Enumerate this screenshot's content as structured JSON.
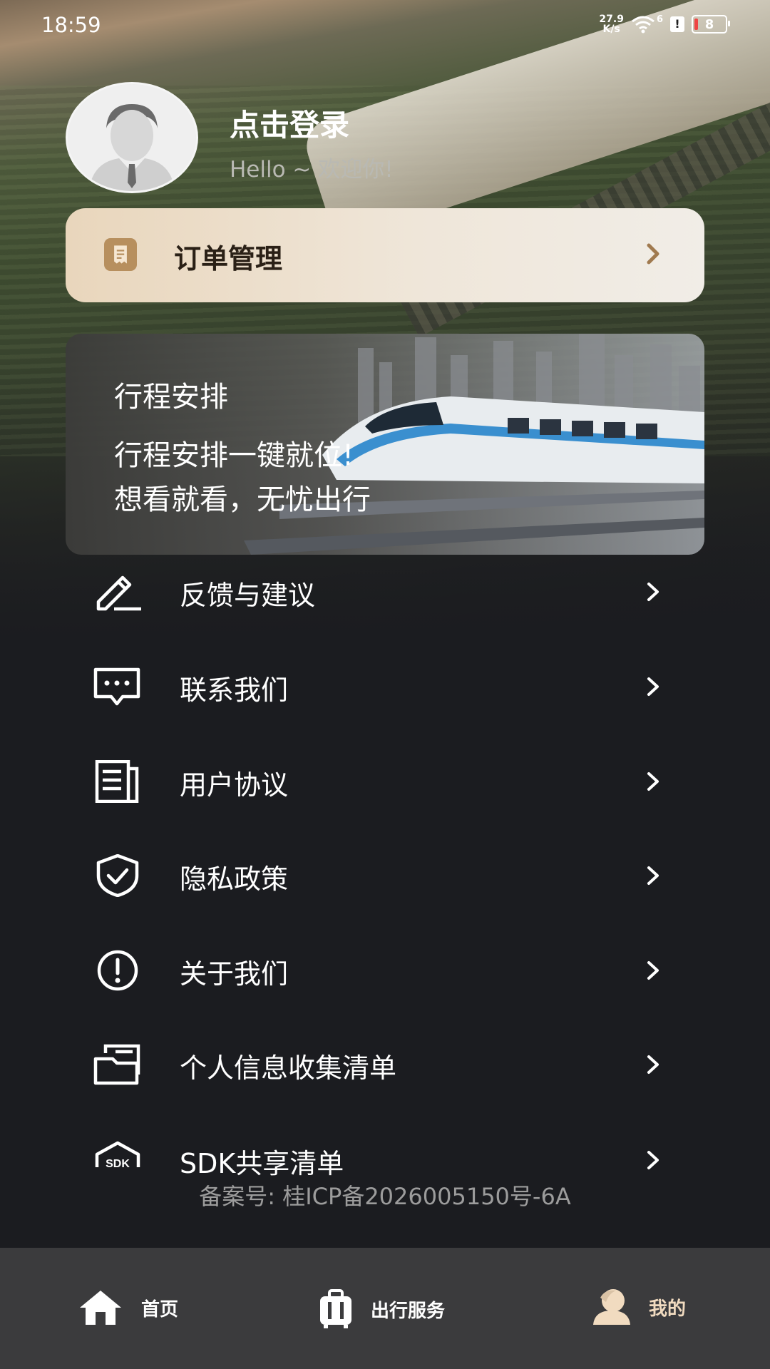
{
  "status": {
    "time": "18:59",
    "net_speed_top": "27.9",
    "net_speed_bottom": "K/s",
    "wifi_badge": "6",
    "alert": "!",
    "battery": "8"
  },
  "profile": {
    "title": "点击登录",
    "subtitle": "Hello ~ 欢迎你!"
  },
  "order": {
    "label": "订单管理"
  },
  "trip": {
    "title": "行程安排",
    "line1": "行程安排一键就位!",
    "line2": "想看就看，无忧出行"
  },
  "menu": {
    "items": [
      {
        "label": "反馈与建议",
        "icon": "edit-icon"
      },
      {
        "label": "联系我们",
        "icon": "chat-icon"
      },
      {
        "label": "用户协议",
        "icon": "document-icon"
      },
      {
        "label": "隐私政策",
        "icon": "shield-check-icon"
      },
      {
        "label": "关于我们",
        "icon": "info-icon"
      },
      {
        "label": "个人信息收集清单",
        "icon": "folder-icon"
      },
      {
        "label": "SDK共享清单",
        "icon": "sdk-icon"
      }
    ]
  },
  "icp": "备案号: 桂ICP备2026005150号-6A",
  "tabs": [
    {
      "label": "首页",
      "icon": "home-icon",
      "active": false
    },
    {
      "label": "出行服务",
      "icon": "luggage-icon",
      "active": false
    },
    {
      "label": "我的",
      "icon": "user-icon",
      "active": true
    }
  ],
  "colors": {
    "accent": "#f1dbc0",
    "background": "#1b1c20",
    "tabbar": "#3b3b3d"
  }
}
